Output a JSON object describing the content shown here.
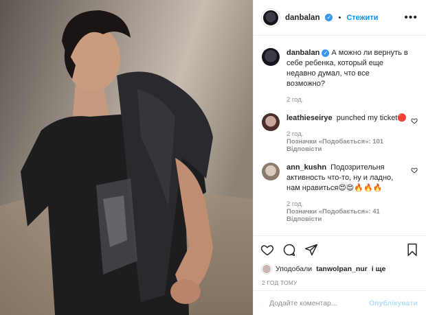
{
  "post": {
    "author": "danbalan",
    "follow_label": "Стежити",
    "more_label": "•••",
    "caption_author": "danbalan",
    "caption_text": "А можно ли вернуть в себе ребенка, который еще недавно думал, что все возможно?",
    "caption_time": "2 год."
  },
  "comments": [
    {
      "author": "leathieseirye",
      "text": "punched my ticket",
      "emoji": "🔴",
      "time": "2 год.",
      "likes": "Позначки «Подобається»: 101",
      "reply": "Відповісти"
    },
    {
      "author": "ann_kushn",
      "text": "Подозрительня активность что-то, ну и ладно, нам нравиться",
      "emoji": "😍😍🔥🔥🔥",
      "time": "2 год.",
      "likes": "Позначки «Подобається»: 41",
      "reply": "Відповісти"
    }
  ],
  "likes": {
    "prefix": "Уподобали",
    "user": "tanwolpan_nur",
    "suffix": "і ще"
  },
  "timestamp": "2 ГОД ТОМУ",
  "add_comment": {
    "placeholder": "Додайте коментар...",
    "publish_label": "Опублікувати"
  },
  "icons": {
    "verified": "verified-badge-icon",
    "like": "heart-icon",
    "comment": "comment-bubble-icon",
    "share": "paper-plane-icon",
    "save": "bookmark-icon",
    "emoji": "smiley-icon"
  },
  "colors": {
    "accent": "#0095f6",
    "verified": "#3897f0",
    "muted": "#8e8e8e",
    "publish_disabled": "#b2dffc"
  }
}
